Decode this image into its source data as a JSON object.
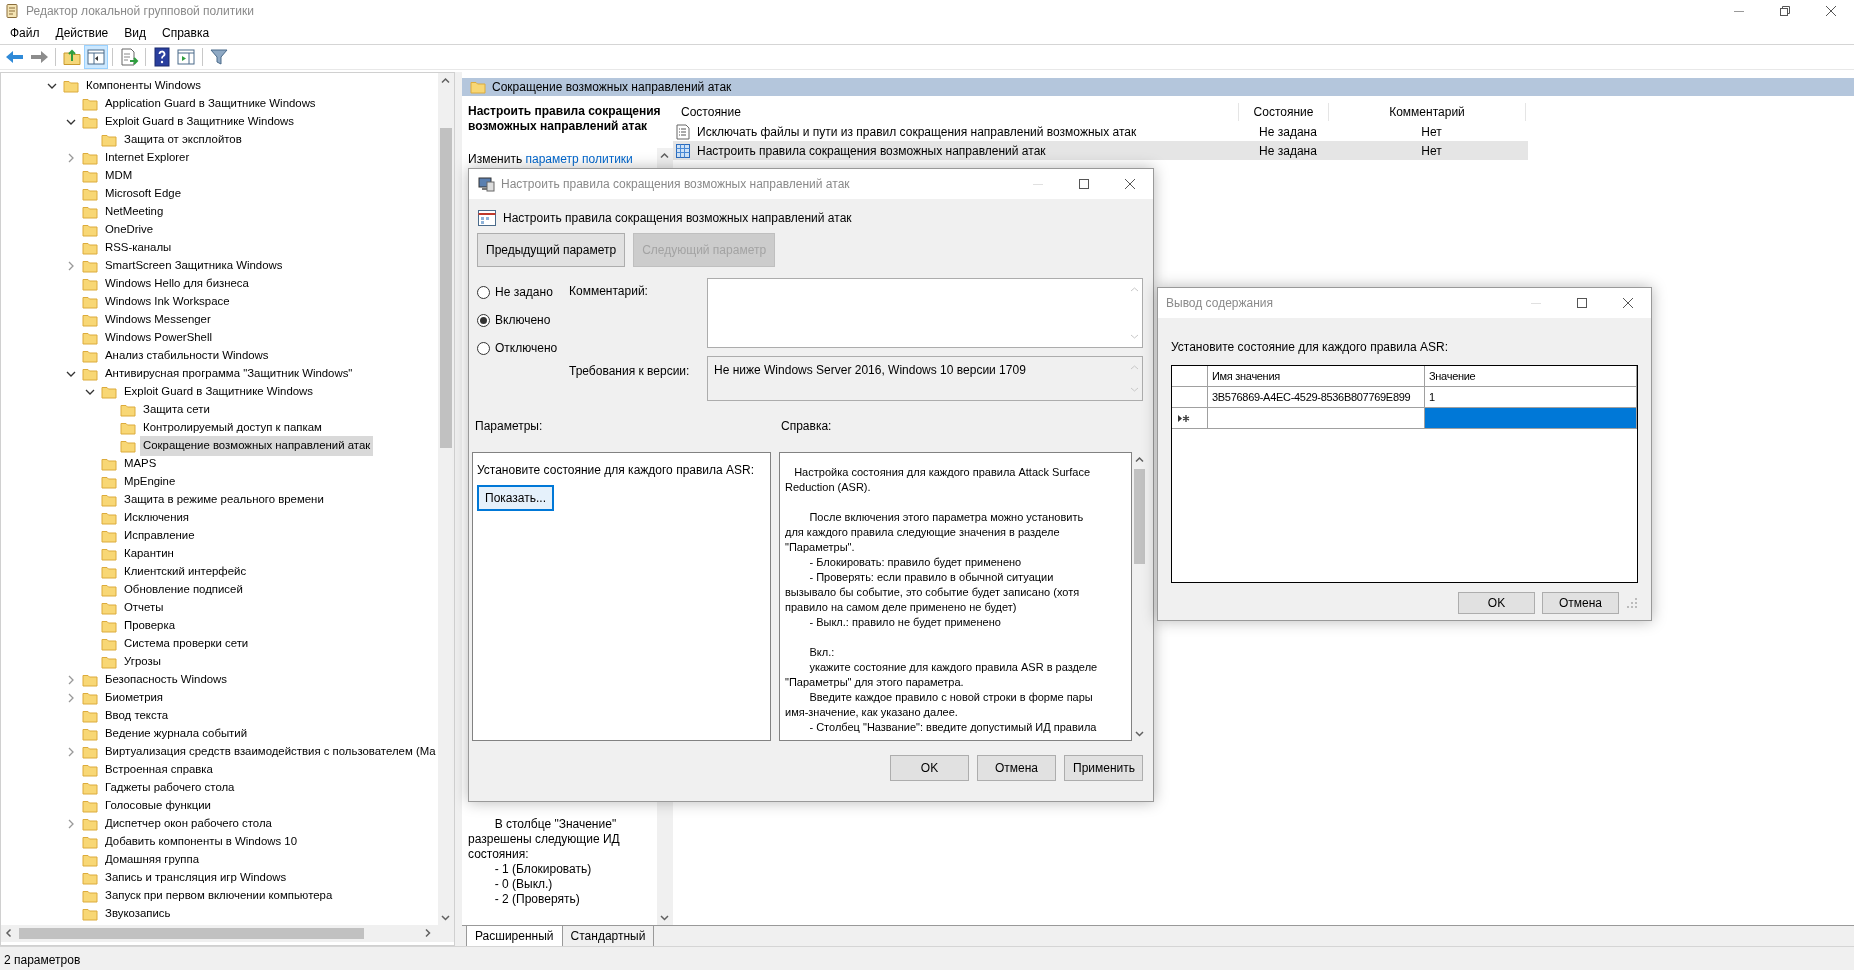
{
  "window": {
    "title": "Редактор локальной групповой политики"
  },
  "menu": [
    "Файл",
    "Действие",
    "Вид",
    "Справка"
  ],
  "toolbar": {
    "forward_disabled": true,
    "tree_toggle_pressed": true
  },
  "tree": {
    "items": [
      {
        "label": "Компоненты Windows",
        "selected": false,
        "expanded": true,
        "children": [
          {
            "label": "Application Guard в Защитнике Windows",
            "selected": false
          },
          {
            "label": "Exploit Guard в Защитнике Windows",
            "selected": false,
            "expanded": true,
            "children": [
              {
                "label": "Защита от эксплойтов",
                "selected": false
              }
            ]
          },
          {
            "label": "Internet Explorer",
            "selected": false,
            "expanded": false
          },
          {
            "label": "MDM",
            "selected": false
          },
          {
            "label": "Microsoft Edge",
            "selected": false
          },
          {
            "label": "NetMeeting",
            "selected": false
          },
          {
            "label": "OneDrive",
            "selected": false
          },
          {
            "label": "RSS-каналы",
            "selected": false
          },
          {
            "label": "SmartScreen Защитника Windows",
            "selected": false,
            "expanded": false
          },
          {
            "label": "Windows Hello для бизнеса",
            "selected": false
          },
          {
            "label": "Windows Ink Workspace",
            "selected": false
          },
          {
            "label": "Windows Messenger",
            "selected": false
          },
          {
            "label": "Windows PowerShell",
            "selected": false
          },
          {
            "label": "Анализ стабильности Windows",
            "selected": false
          },
          {
            "label": "Антивирусная программа \"Защитник Windows\"",
            "selected": false,
            "expanded": true,
            "children": [
              {
                "label": "Exploit Guard в Защитнике Windows",
                "selected": false,
                "expanded": true,
                "children": [
                  {
                    "label": "Защита сети",
                    "selected": false
                  },
                  {
                    "label": "Контролируемый доступ к папкам",
                    "selected": false
                  },
                  {
                    "label": "Сокращение возможных направлений атак",
                    "selected": true
                  }
                ]
              },
              {
                "label": "MAPS",
                "selected": false
              },
              {
                "label": "MpEngine",
                "selected": false
              },
              {
                "label": "Защита в режиме реального времени",
                "selected": false
              },
              {
                "label": "Исключения",
                "selected": false
              },
              {
                "label": "Исправление",
                "selected": false
              },
              {
                "label": "Карантин",
                "selected": false
              },
              {
                "label": "Клиентский интерфейс",
                "selected": false
              },
              {
                "label": "Обновление подписей",
                "selected": false
              },
              {
                "label": "Отчеты",
                "selected": false
              },
              {
                "label": "Проверка",
                "selected": false
              },
              {
                "label": "Система проверки сети",
                "selected": false
              },
              {
                "label": "Угрозы",
                "selected": false
              }
            ]
          },
          {
            "label": "Безопасность Windows",
            "selected": false,
            "expanded": false
          },
          {
            "label": "Биометрия",
            "selected": false,
            "expanded": false
          },
          {
            "label": "Ввод текста",
            "selected": false
          },
          {
            "label": "Ведение журнала событий",
            "selected": false
          },
          {
            "label": "Виртуализация средств взаимодействия с пользователем (Ма",
            "selected": false,
            "expanded": false
          },
          {
            "label": "Встроенная справка",
            "selected": false
          },
          {
            "label": "Гаджеты рабочего стола",
            "selected": false
          },
          {
            "label": "Голосовые функции",
            "selected": false
          },
          {
            "label": "Диспетчер окон рабочего стола",
            "selected": false,
            "expanded": false
          },
          {
            "label": "Добавить компоненты в Windows 10",
            "selected": false
          },
          {
            "label": "Домашняя группа",
            "selected": false
          },
          {
            "label": "Запись и трансляция игр Windows",
            "selected": false
          },
          {
            "label": "Запуск при первом включении компьютера",
            "selected": false
          },
          {
            "label": "Звукозапись",
            "selected": false
          }
        ]
      }
    ]
  },
  "details": {
    "header": "Сокращение возможных направлений атак",
    "description": {
      "title": "Настроить правила сокращения возможных направлений атак",
      "edit_prefix": "Изменить",
      "edit_link": "параметр политики",
      "help": "        В столбце \"Значение\"\nразрешены следующие ИД\nсостояния:\n        - 1 (Блокировать)\n        - 0 (Выкл.)\n        - 2 (Проверять)"
    },
    "columns": [
      "Состояние",
      "Состояние",
      "Комментарий"
    ],
    "rows": [
      {
        "kind": "list",
        "name": "Исключать файлы и пути из правил сокращения направлений возможных атак",
        "state": "Не задана",
        "comment": "Нет",
        "selected": false
      },
      {
        "kind": "setting",
        "name": "Настроить правила сокращения возможных направлений атак",
        "state": "Не задана",
        "comment": "Нет",
        "selected": true
      }
    ],
    "tabs": [
      {
        "label": "Расширенный",
        "selected": true
      },
      {
        "label": "Стандартный",
        "selected": false
      }
    ]
  },
  "status_bar": "2 параметров",
  "policy_dialog": {
    "title": "Настроить правила сокращения возможных направлений атак",
    "heading": "Настроить правила сокращения возможных направлений атак",
    "nav_buttons": [
      {
        "label": "Предыдущий параметр",
        "disabled": false
      },
      {
        "label": "Следующий параметр",
        "disabled": true
      }
    ],
    "options": [
      {
        "label": "Не задано",
        "selected": false
      },
      {
        "label": "Включено",
        "selected": true
      },
      {
        "label": "Отключено",
        "selected": false
      }
    ],
    "comment_label": "Комментарий:",
    "version_label": "Требования к версии:",
    "version": "Не ниже Windows Server 2016, Windows 10 версии 1709",
    "options_label": "Параметры:",
    "help_label": "Справка:",
    "options_prompt": "Установите состояние для каждого правила ASR:",
    "show_button": "Показать...",
    "help": [
      "   Настройка состояния для каждого правила Attack Surface\nReduction (ASR).",
      "        После включения этого параметра можно установить\nдля каждого правила следующие значения в разделе\n\"Параметры\".\n        - Блокировать: правило будет применено\n        - Проверять: если правило в обычной ситуации\nвызывало бы событие, это событие будет записано (хотя\nправило на самом деле применено не будет)\n        - Выкл.: правило не будет применено",
      "        Вкл.:\n        укажите состояние для каждого правила ASR в разделе\n\"Параметры\" для этого параметра.\n        Введите каждое правило с новой строки в форме пары\nимя-значение, как указано далее.\n        - Столбец \"Название\": введите допустимый ИД правила"
    ],
    "footer": [
      "OK",
      "Отмена",
      "Применить"
    ]
  },
  "show_dialog": {
    "title": "Вывод содержания",
    "prompt": "Установите состояние для каждого правила ASR:",
    "columns": [
      "Имя значения",
      "Значение"
    ],
    "rows": [
      {
        "kind": "data",
        "name": "3B576869-A4EC-4529-8536B807769E899",
        "value": "1",
        "selected": false
      },
      {
        "kind": "new",
        "selected": true
      }
    ],
    "buttons": [
      "OK",
      "Отмена"
    ]
  }
}
